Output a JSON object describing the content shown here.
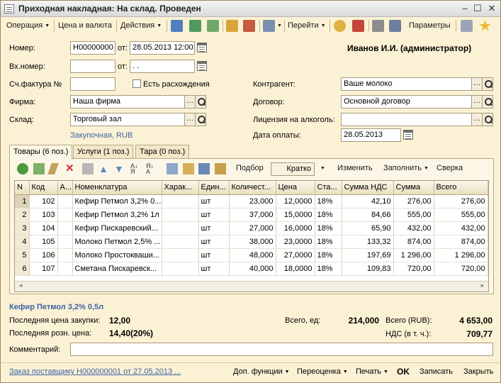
{
  "window": {
    "title": "Приходная накладная: На склад. Проведен"
  },
  "toolbar": {
    "operation": "Операция",
    "price_currency": "Цена и валюта",
    "actions": "Действия",
    "goto": "Перейти",
    "params": "Параметры"
  },
  "form": {
    "number_label": "Номер:",
    "number_value": "Н00000000",
    "from_label": "от:",
    "date_value": "28.05.2013 12:00:",
    "user": "Иванов И.И. (администратор)",
    "in_number_label": "Вх.номер:",
    "in_number_value": "",
    "in_from_label": "от:",
    "in_date_value": " .  .",
    "invoice_label": "Сч.фактура №",
    "invoice_value": "",
    "discrepancy_label": "Есть расхождения",
    "counterparty_label": "Контрагент:",
    "counterparty_value": "Ваше молоко",
    "firm_label": "Фирма:",
    "firm_value": "Наша фирма",
    "contract_label": "Договор:",
    "contract_value": "Основной договор",
    "warehouse_label": "Склад:",
    "warehouse_value": "Торговый зал",
    "license_label": "Лицензия на алкоголь:",
    "license_value": "",
    "price_type_link": "Закупочная, RUB",
    "payment_date_label": "Дата оплаты:",
    "payment_date_value": "28.05.2013"
  },
  "tabs": [
    {
      "label": "Товары (6 поз.)"
    },
    {
      "label": "Услуги (1 поз.)"
    },
    {
      "label": "Тара (0 поз.)"
    }
  ],
  "grid_toolbar": {
    "pick": "Подбор",
    "brief": "Кратко",
    "change": "Изменить",
    "fill": "Заполнить",
    "check": "Сверка"
  },
  "table": {
    "headers": [
      "N",
      "Код",
      "А...",
      "Номенклатура",
      "Харак...",
      "Един...",
      "Количест...",
      "Цена",
      "Ста...",
      "Сумма НДС",
      "Сумма",
      "Всего"
    ],
    "rows": [
      {
        "n": "1",
        "code": "102",
        "a": "",
        "name": "Кефир Петмол 3,2% 0...",
        "char": "",
        "unit": "шт",
        "qty": "23,000",
        "price": "12,0000",
        "rate": "18%",
        "vat": "42,10",
        "sum": "276,00",
        "total": "276,00"
      },
      {
        "n": "2",
        "code": "103",
        "a": "",
        "name": "Кефир Петмол 3,2% 1л",
        "char": "",
        "unit": "шт",
        "qty": "37,000",
        "price": "15,0000",
        "rate": "18%",
        "vat": "84,66",
        "sum": "555,00",
        "total": "555,00"
      },
      {
        "n": "3",
        "code": "104",
        "a": "",
        "name": "Кефир Пискаревский...",
        "char": "",
        "unit": "шт",
        "qty": "27,000",
        "price": "16,0000",
        "rate": "18%",
        "vat": "65,90",
        "sum": "432,00",
        "total": "432,00"
      },
      {
        "n": "4",
        "code": "105",
        "a": "",
        "name": "Молоко Петмол 2,5% ...",
        "char": "",
        "unit": "шт",
        "qty": "38,000",
        "price": "23,0000",
        "rate": "18%",
        "vat": "133,32",
        "sum": "874,00",
        "total": "874,00"
      },
      {
        "n": "5",
        "code": "106",
        "a": "",
        "name": "Молоко Простокваши...",
        "char": "",
        "unit": "шт",
        "qty": "48,000",
        "price": "27,0000",
        "rate": "18%",
        "vat": "197,69",
        "sum": "1 296,00",
        "total": "1 296,00"
      },
      {
        "n": "6",
        "code": "107",
        "a": "",
        "name": "Сметана Пискаревск...",
        "char": "",
        "unit": "шт",
        "qty": "40,000",
        "price": "18,0000",
        "rate": "18%",
        "vat": "109,83",
        "sum": "720,00",
        "total": "720,00"
      }
    ]
  },
  "summary": {
    "selected_item": "Кефир Петмол 3,2% 0,5л",
    "last_purchase_label": "Последняя цена закупки:",
    "last_purchase_value": "12,00",
    "last_retail_label": "Последняя розн. цена:",
    "last_retail_value": "14,40(20%)",
    "total_qty_label": "Всего, ед:",
    "total_qty_value": "214,000",
    "total_rub_label": "Всего (RUB):",
    "total_rub_value": "4 653,00",
    "vat_label": "НДС (в т. ч.):",
    "vat_value": "709,77",
    "comment_label": "Комментарий:",
    "comment_value": ""
  },
  "bottom": {
    "order_link": "Заказ поставщику Н000000001 от 27.05.2013 ...",
    "extra": "Доп. функции",
    "reprice": "Переоценка",
    "print": "Печать",
    "ok": "OK",
    "write": "Записать",
    "close": "Закрыть"
  }
}
